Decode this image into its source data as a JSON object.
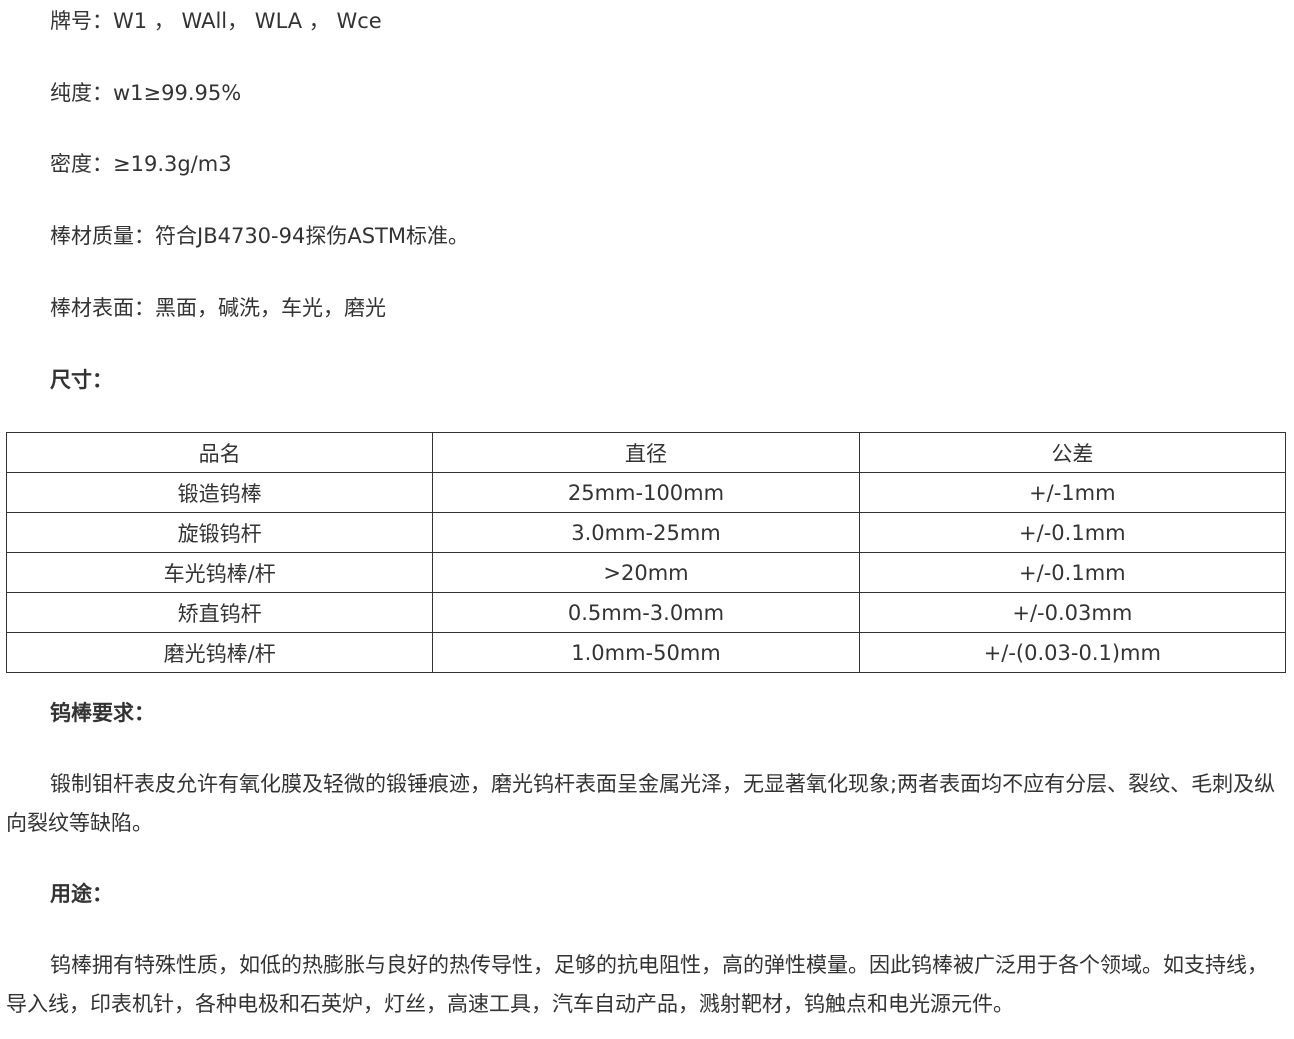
{
  "lines": {
    "grade": "牌号：W1 ， WAll， WLA ， Wce",
    "purity": "纯度：w1≥99.95%",
    "density": "密度：≥19.3g/m3",
    "quality": "棒材质量：符合JB4730-94探伤ASTM标准。",
    "surface": "棒材表面：黑面，碱洗，车光，磨光"
  },
  "headings": {
    "size": "尺寸：",
    "requirements": "钨棒要求：",
    "usage": "用途："
  },
  "table": {
    "headers": [
      "品名",
      "直径",
      "公差"
    ],
    "rows": [
      [
        "锻造钨棒",
        "25mm-100mm",
        "+/-1mm"
      ],
      [
        "旋锻钨杆",
        "3.0mm-25mm",
        "+/-0.1mm"
      ],
      [
        "车光钨棒/杆",
        ">20mm",
        "+/-0.1mm"
      ],
      [
        "矫直钨杆",
        "0.5mm-3.0mm",
        "+/-0.03mm"
      ],
      [
        "磨光钨棒/杆",
        "1.0mm-50mm",
        "+/-(0.03-0.1)mm"
      ]
    ]
  },
  "paragraphs": {
    "requirements": "锻制钼杆表皮允许有氧化膜及轻微的锻锤痕迹，磨光钨杆表面呈金属光泽，无显著氧化现象;两者表面均不应有分层、裂纹、毛刺及纵向裂纹等缺陷。",
    "usage": "钨棒拥有特殊性质，如低的热膨胀与良好的热传导性，足够的抗电阻性，高的弹性模量。因此钨棒被广泛用于各个领域。如支持线，导入线，印表机针，各种电极和石英炉，灯丝，高速工具，汽车自动产品，溅射靶材，钨触点和电光源元件。"
  }
}
